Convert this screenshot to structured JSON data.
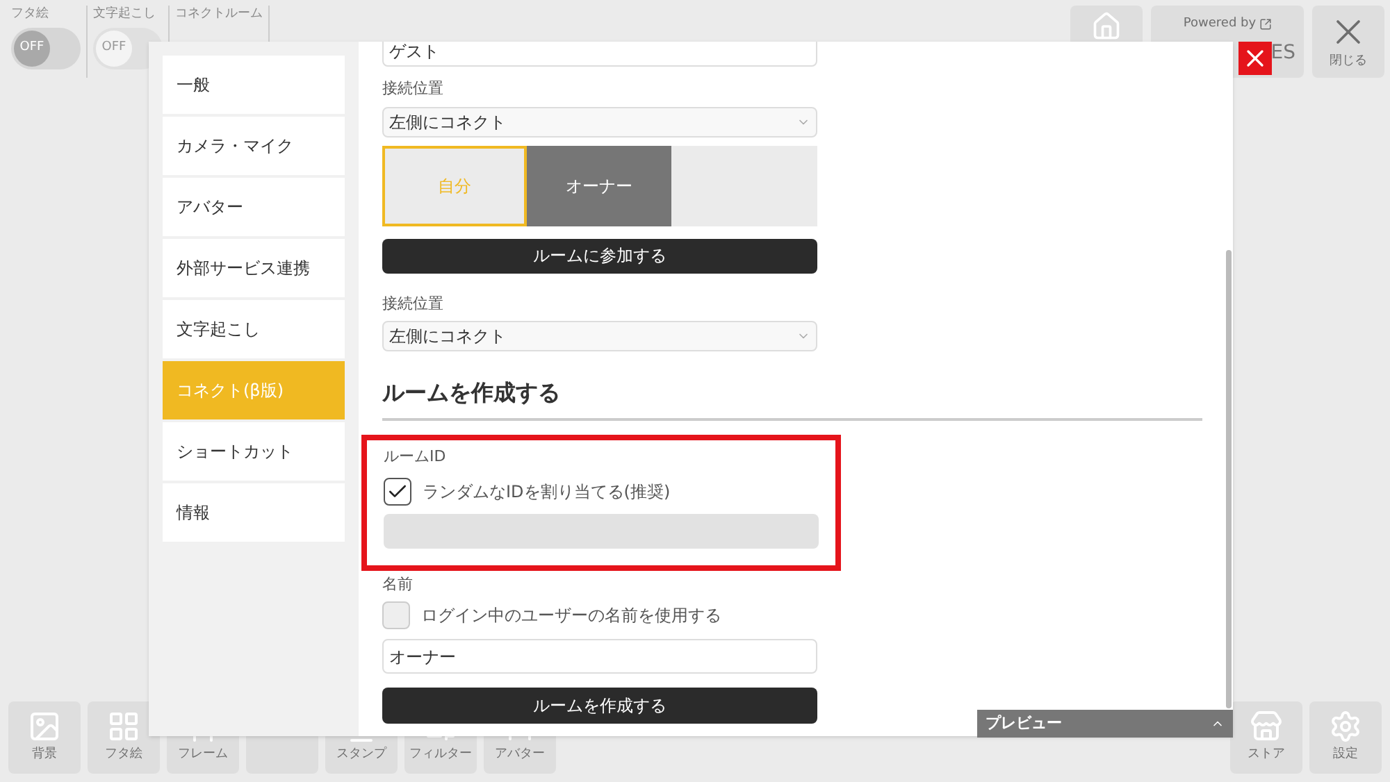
{
  "top_toggles": [
    {
      "label": "フタ絵",
      "value": "OFF",
      "on": false,
      "disabled": false
    },
    {
      "label": "文字起こし",
      "value": "OFF",
      "on": false,
      "disabled": true
    },
    {
      "label": "コネクトルーム"
    }
  ],
  "top_buttons": [
    {
      "kind": "home"
    },
    {
      "kind": "powered",
      "label": "Powered by",
      "sub": "ES"
    },
    {
      "kind": "close",
      "label": "閉じる"
    }
  ],
  "bottom_left": [
    {
      "kind": "image",
      "label": "背景"
    },
    {
      "kind": "lid",
      "label": "フタ絵"
    },
    {
      "kind": "frame",
      "label": "フレーム"
    },
    {
      "kind": "blank"
    },
    {
      "kind": "stamp",
      "label": "スタンプ"
    },
    {
      "kind": "filter",
      "label": "フィルター"
    },
    {
      "kind": "avatar",
      "label": "アバター"
    }
  ],
  "bottom_right": [
    {
      "kind": "store",
      "label": "ストア"
    },
    {
      "kind": "settings",
      "label": "設定"
    }
  ],
  "preview": {
    "label": "プレビュー",
    "expanded": false
  },
  "sidebar": {
    "items": [
      {
        "label": "一般",
        "selected": false
      },
      {
        "label": "カメラ・マイク",
        "selected": false
      },
      {
        "label": "アバター",
        "selected": false
      },
      {
        "label": "外部サービス連携",
        "selected": false
      },
      {
        "label": "文字起こし",
        "selected": false
      },
      {
        "label": "コネクト(β版)",
        "selected": true
      },
      {
        "label": "ショートカット",
        "selected": false
      },
      {
        "label": "情報",
        "selected": false
      }
    ]
  },
  "join": {
    "name_value": "ゲスト",
    "position_label": "接続位置",
    "position_value": "左側にコネクト",
    "seats": [
      {
        "kind": "member",
        "label": "自分",
        "selected": true
      },
      {
        "kind": "member",
        "label": "オーナー",
        "selected": false
      },
      {
        "kind": "empty"
      }
    ],
    "button": "ルームに参加する",
    "position_label_2": "接続位置",
    "position_value_2": "左側にコネクト"
  },
  "create": {
    "heading": "ルームを作成する",
    "room_id_label": "ルームID",
    "random_id": {
      "label": "ランダムなIDを割り当てる(推奨)",
      "checked": true
    },
    "room_id_field": {
      "disabled": true
    },
    "name_label": "名前",
    "use_login_name": {
      "label": "ログイン中のユーザーの名前を使用する",
      "checked": false
    },
    "name_value": "オーナー",
    "button": "ルームを作成する",
    "highlighted": true
  }
}
